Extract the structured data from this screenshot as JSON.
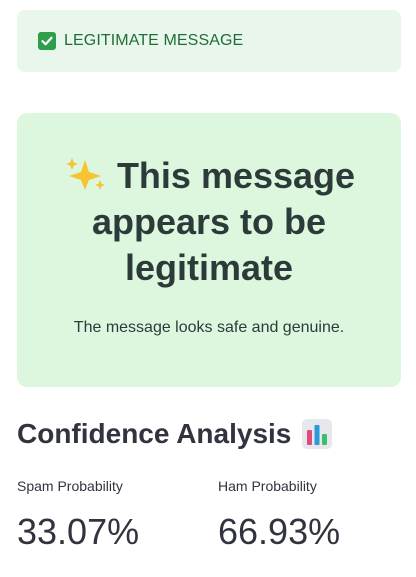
{
  "alert": {
    "icon": "check-box-icon",
    "text": "LEGITIMATE MESSAGE"
  },
  "result": {
    "icon": "sparkles-icon",
    "title": "This message appears to be legitimate",
    "subtitle": "The message looks safe and genuine."
  },
  "confidence": {
    "heading": "Confidence Analysis",
    "icon": "bar-chart-icon",
    "metrics": [
      {
        "label": "Spam Probability",
        "value": "33.07%"
      },
      {
        "label": "Ham Probability",
        "value": "66.93%"
      }
    ]
  },
  "colors": {
    "alert_bg": "#e8f6ec",
    "alert_text": "#1f6e34",
    "check_bg": "#2e9e4a",
    "card_bg": "#dcf7de",
    "text": "#31333f"
  }
}
